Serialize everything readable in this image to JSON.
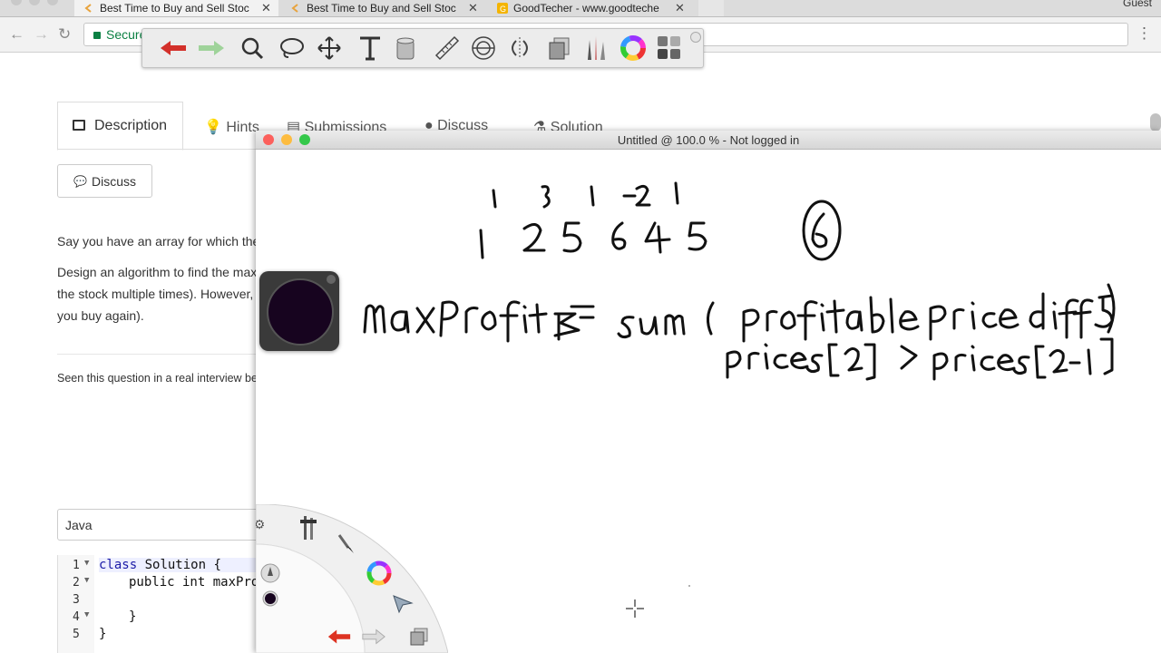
{
  "browser": {
    "tabs": [
      {
        "title": "Best Time to Buy and Sell Stoc",
        "active": true
      },
      {
        "title": "Best Time to Buy and Sell Stoc",
        "active": false
      },
      {
        "title": "GoodTecher - www.goodteche",
        "active": false
      }
    ],
    "profile": "Guest",
    "address": {
      "secure_label": "Secure"
    }
  },
  "toolbar": {
    "tools": [
      "undo-icon",
      "redo-icon",
      "magnifier-icon",
      "lasso-icon",
      "move-icon",
      "text-tool-icon",
      "bucket-icon",
      "ruler-icon",
      "stamp-icon",
      "mirror-icon",
      "layers-icon",
      "pencils-icon",
      "color-wheel-icon",
      "grid-icon"
    ]
  },
  "page": {
    "tabs": {
      "description": "Description",
      "hints": "Hints",
      "submissions": "Submissions",
      "discuss": "Discuss",
      "solution": "Solution"
    },
    "discuss_button": "Discuss",
    "paragraph_1": "Say you have an array for which the",
    "paragraph_2_line_1": "Design an algorithm to find the max",
    "paragraph_2_line_2": "the stock multiple times). However,",
    "paragraph_2_line_3": "you buy again).",
    "interview_prompt": "Seen this question in a real interview be",
    "language": "Java",
    "code": {
      "line_numbers": [
        "1",
        "2",
        "3",
        "4",
        "5"
      ],
      "line_1_kw": "class",
      "line_1_rest": " Solution {",
      "line_2_kw": "public int",
      "line_2_rest": " maxPro",
      "line_4": "}",
      "line_5": "}"
    }
  },
  "drawing": {
    "window_title": "Untitled @ 100.0 % - Not logged in",
    "colors": {
      "ink": "#111111",
      "puck": "#17041f"
    },
    "radial_tools": [
      "settings-icon",
      "brushes-icon",
      "brush-icon",
      "pencil-icon",
      "color-dot-icon",
      "color-wheel-icon",
      "select-arrow-icon",
      "undo-icon",
      "redo-icon",
      "layers-icon"
    ]
  }
}
